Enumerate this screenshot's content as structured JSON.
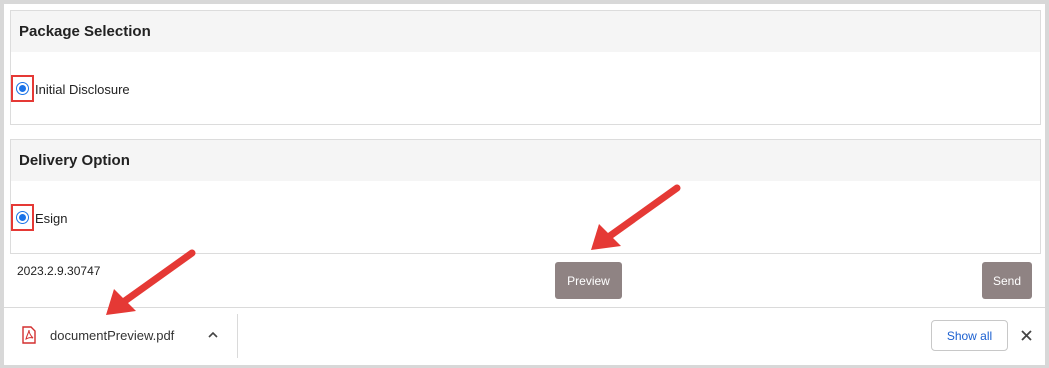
{
  "package_section": {
    "title": "Package Selection",
    "option_label": "Initial Disclosure",
    "selected": true
  },
  "delivery_section": {
    "title": "Delivery Option",
    "option_label": "Esign",
    "selected": true
  },
  "footer": {
    "version": "2023.2.9.30747",
    "preview_label": "Preview",
    "send_label": "Send"
  },
  "download_bar": {
    "file_name": "documentPreview.pdf",
    "show_all_label": "Show all",
    "file_icon": "pdf-icon",
    "expand_icon": "chevron-up-icon",
    "close_icon": "close-icon"
  },
  "colors": {
    "annotation_red": "#e53935",
    "radio_blue": "#1a73e8",
    "button_gray": "#8f8383",
    "link_blue": "#1a5fd0"
  }
}
